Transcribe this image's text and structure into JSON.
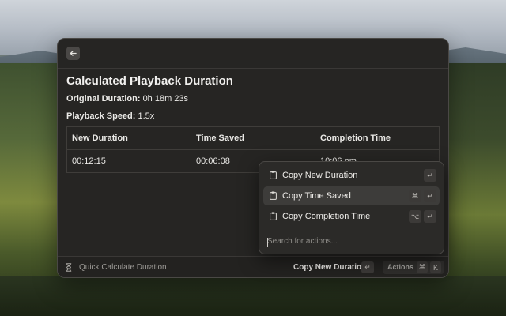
{
  "window": {
    "title": "Calculated Playback Duration",
    "original_duration_label": "Original Duration:",
    "original_duration_value": "0h 18m 23s",
    "playback_speed_label": "Playback Speed:",
    "playback_speed_value": "1.5x"
  },
  "table": {
    "headers": [
      "New Duration",
      "Time Saved",
      "Completion Time"
    ],
    "row": [
      "00:12:15",
      "00:06:08",
      "10:06 pm"
    ]
  },
  "menu": {
    "items": [
      {
        "label": "Copy New Duration",
        "shortcut_mod": "",
        "shortcut_key": "↵"
      },
      {
        "label": "Copy Time Saved",
        "shortcut_mod": "⌘",
        "shortcut_key": "↵"
      },
      {
        "label": "Copy Completion Time",
        "shortcut_mod": "⌥",
        "shortcut_key": "↵"
      }
    ],
    "search_placeholder": "Search for actions..."
  },
  "footer": {
    "command_name": "Quick Calculate Duration",
    "primary_action": "Copy New Duration",
    "primary_key": "↵",
    "actions_label": "Actions",
    "actions_mod": "⌘",
    "actions_key": "K"
  },
  "colors": {
    "window_bg": "#262523",
    "selected_item_bg": "#3d3c3a",
    "text_primary": "#f1f0ee",
    "text_muted": "#9d9b97"
  },
  "icons": {
    "back": "arrow-left-icon",
    "clipboard": "clipboard-icon",
    "hourglass": "hourglass-icon"
  }
}
